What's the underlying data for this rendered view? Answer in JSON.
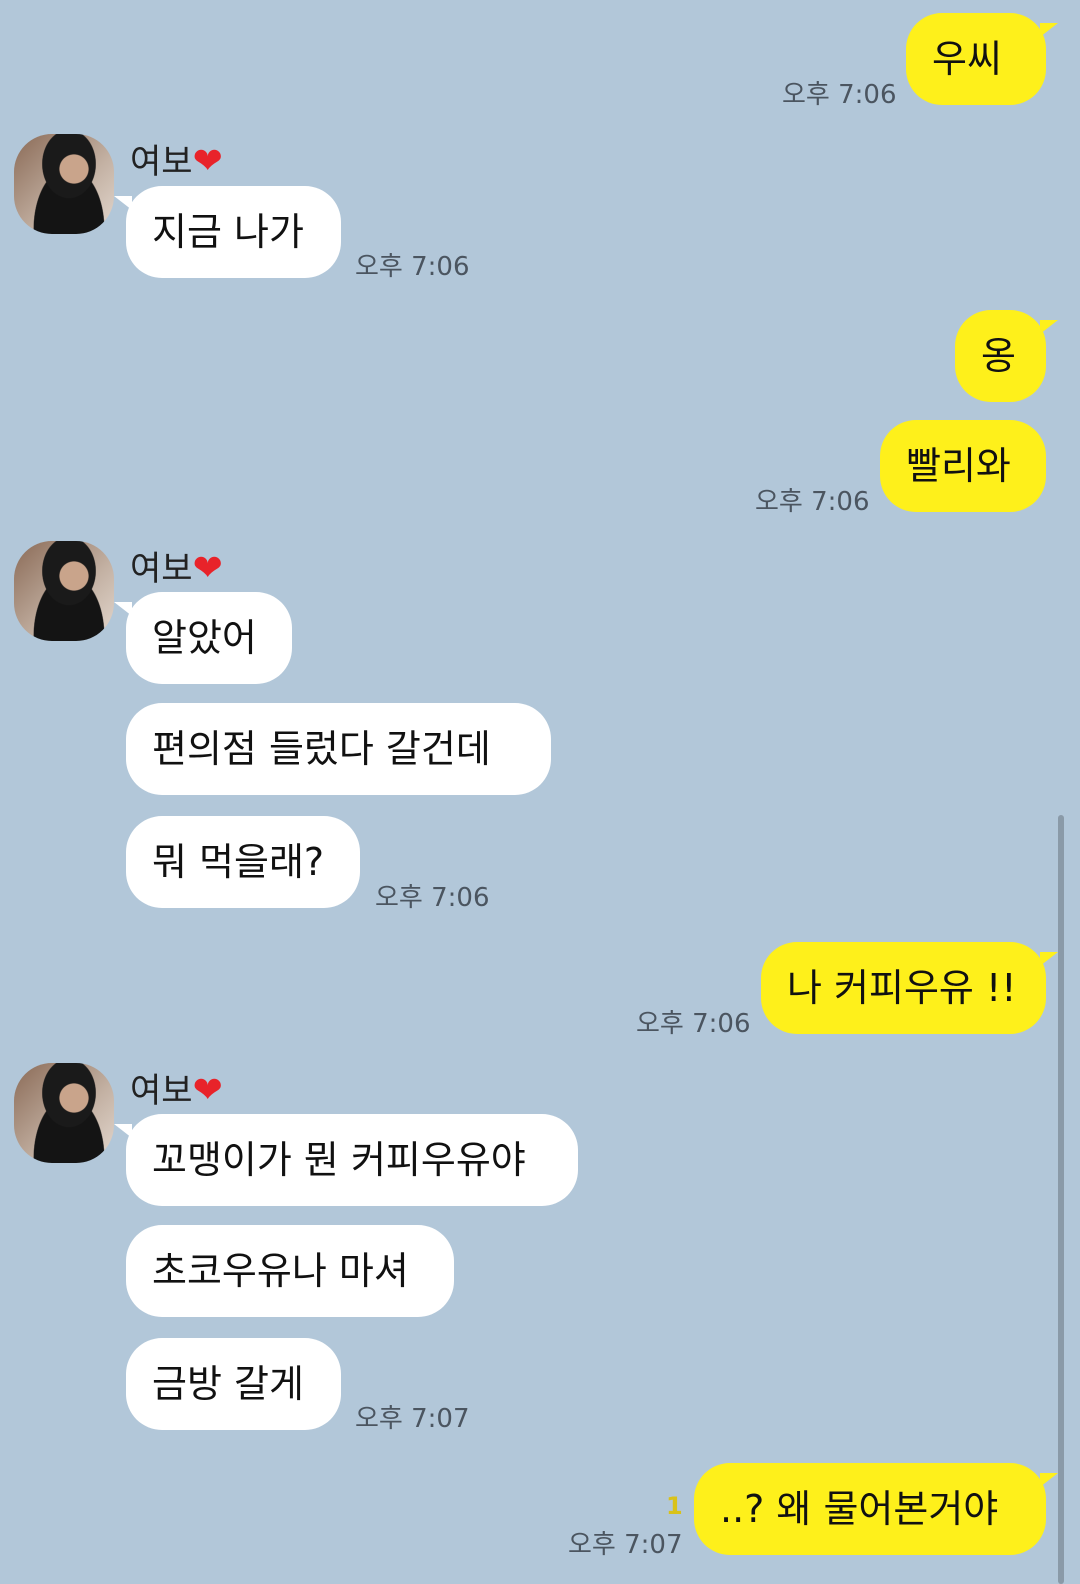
{
  "contact": {
    "name": "여보",
    "heart": "❤"
  },
  "messages": [
    {
      "text": "우씨",
      "time": "오후 7:06"
    },
    {
      "text": "지금 나가",
      "time": "오후 7:06"
    },
    {
      "text": "옹"
    },
    {
      "text": "빨리와",
      "time": "오후 7:06"
    },
    {
      "text": "알았어"
    },
    {
      "text": "편의점 들렀다 갈건데"
    },
    {
      "text": "뭐 먹을래?",
      "time": "오후 7:06"
    },
    {
      "text": "나 커피우유 !!",
      "time": "오후 7:06"
    },
    {
      "text": "꼬맹이가 뭔 커피우유야"
    },
    {
      "text": "초코우유나 마셔"
    },
    {
      "text": "금방 갈게",
      "time": "오후 7:07"
    },
    {
      "text": "..? 왜 물어본거야",
      "time": "오후 7:07",
      "unread": "1"
    }
  ],
  "colors": {
    "background": "#b2c7d9",
    "outgoing_bubble": "#fef01b",
    "incoming_bubble": "#ffffff"
  }
}
